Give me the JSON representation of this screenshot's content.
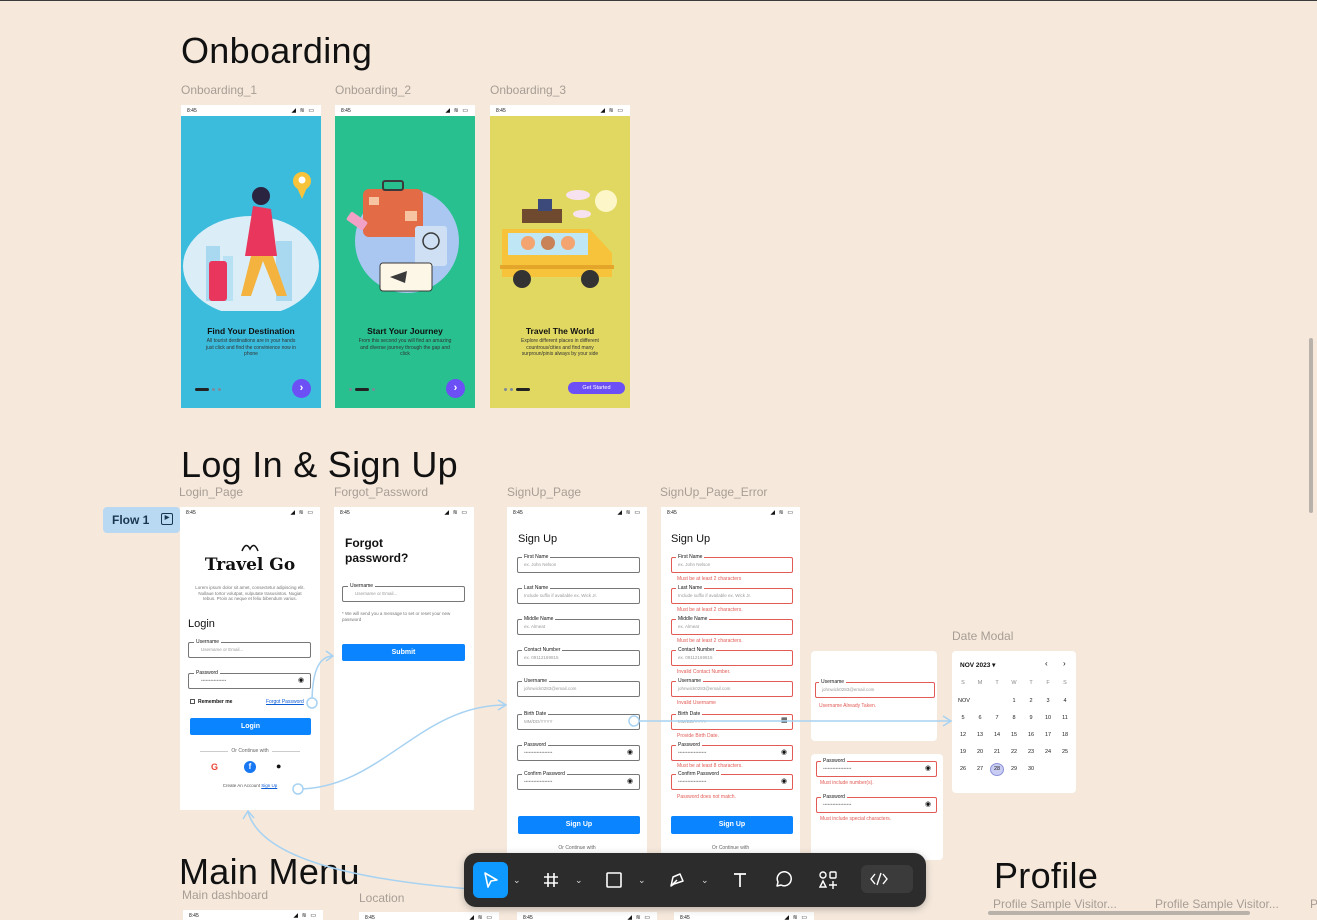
{
  "sections": {
    "onboarding": "Onboarding",
    "login_signup": "Log In & Sign Up",
    "main_menu": "Main Menu",
    "profile": "Profile"
  },
  "frame_labels": {
    "onboarding_1": "Onboarding_1",
    "onboarding_2": "Onboarding_2",
    "onboarding_3": "Onboarding_3",
    "login_page": "Login_Page",
    "forgot_password": "Forgot_Password",
    "signup_page": "SignUp_Page",
    "signup_page_error": "SignUp_Page_Error",
    "date_modal": "Date Modal",
    "main_dashboard": "Main dashboard",
    "location": "Location",
    "profile_visitor_1": "Profile Sample Visitor...",
    "profile_visitor_2": "Profile Sample Visitor...",
    "profile_cut": "P"
  },
  "status_time": "8:45",
  "onboarding": [
    {
      "title": "Find Your Destination",
      "body": "All tourist destinations are in your hands just click and find the convinience now in phone",
      "bg": "#3bbcdc"
    },
    {
      "title": "Start Your Journey",
      "body": "From this second you will find an amazing and diverse journey through the gap and click",
      "bg": "#27c08e"
    },
    {
      "title": "Travel The World",
      "body": "Explore different places in diifferent countrous/cities and find many surproun/pinis always by your side",
      "bg": "#e1d862",
      "cta": "Get Started"
    }
  ],
  "flow_tag": "Flow 1",
  "login": {
    "brand": "Travel Go",
    "intro": "Lorem ipsum dolor sit amet, consectetur adipiscing elit. Nullaue tortor volutpat, vulputate trasusintos. Nugiat tebus. Proin ac neque et feliu bibendum varius.",
    "heading": "Login",
    "username_label": "Username",
    "username_placeholder": "Username or Email...",
    "password_label": "Password",
    "password_value": "••••••••••••••••",
    "remember": "Remember me",
    "forgot_link": "Forgot Password",
    "login_btn": "Login",
    "continue_with": "Or Continue with",
    "create_text": "Create An Account",
    "signup_link": "Sign Up"
  },
  "forgot": {
    "heading": "Forgot password?",
    "username_label": "Username",
    "username_placeholder": "Username or Email...",
    "note": "* We will send you a message to set or reset your new password",
    "submit": "Submit"
  },
  "signup": {
    "heading": "Sign Up",
    "fields": [
      {
        "label": "First Name",
        "placeholder": "ex. John Nelson",
        "error": "Must be at least 2 characters"
      },
      {
        "label": "Last Name",
        "placeholder": "Include suffix if available ex. Wick Jr.",
        "error": "Must be at least 2 characters."
      },
      {
        "label": "Middle Name",
        "placeholder": "ex. Almeat",
        "error": "Must be at least 2 characters."
      },
      {
        "label": "Contact Number",
        "placeholder": "ex. 09112169815",
        "error": "Invalid Contact Number."
      },
      {
        "label": "Username",
        "placeholder": "johnwick0283@email.com",
        "error": "Invalid Username"
      },
      {
        "label": "Birth Date",
        "placeholder": "MM/DD/YYYY",
        "error": "Provide Birth Date."
      },
      {
        "label": "Password",
        "placeholder": "••••••••••••••••••",
        "error": "Must be at least 8 characters."
      },
      {
        "label": "Confirm Password",
        "placeholder": "••••••••••••••••••",
        "error": "Password does not match."
      }
    ],
    "submit": "Sign Up",
    "continue_with": "Or Continue with"
  },
  "error_cards": {
    "username_label": "Username",
    "username_value": "johnwick0283@email.com",
    "username_error": "Username Already Taken.",
    "password_label": "Password",
    "password_error_1": "Must include number(s).",
    "password_error_2": "Must include special characters."
  },
  "calendar": {
    "month": "NOV 2023",
    "weekdays": [
      "S",
      "M",
      "T",
      "W",
      "T",
      "F",
      "S"
    ],
    "month_short": "NOV",
    "days": [
      "1",
      "2",
      "3",
      "4",
      "5",
      "6",
      "7",
      "8",
      "9",
      "10",
      "11",
      "12",
      "13",
      "14",
      "15",
      "16",
      "17",
      "18",
      "19",
      "20",
      "21",
      "22",
      "23",
      "24",
      "25",
      "26",
      "27",
      "28",
      "29",
      "30"
    ],
    "selected": "28"
  },
  "toolbar": {
    "tools": [
      "move-tool",
      "frame-tool",
      "shape-tool",
      "pen-tool",
      "text-tool",
      "comment-tool",
      "actions-tool"
    ],
    "dev_mode": "dev-mode-toggle"
  },
  "colors": {
    "canvas": "#f6e9dc",
    "accent_blue": "#0a84ff",
    "purple": "#6c4ff5",
    "error": "#e25b55",
    "flow_line": "#a7d2f2"
  }
}
